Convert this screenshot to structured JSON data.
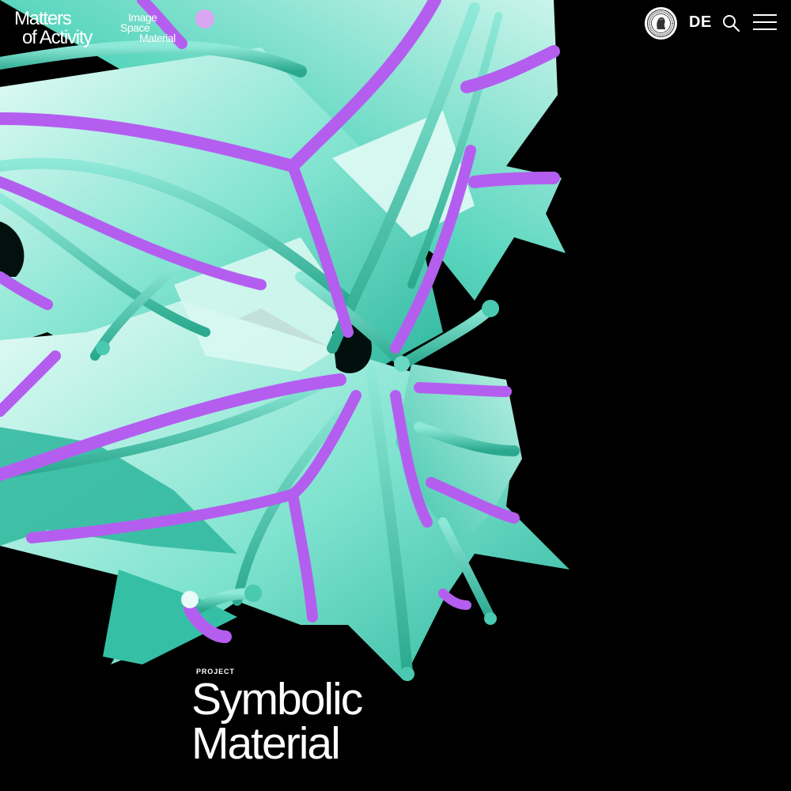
{
  "header": {
    "logo": {
      "line1": "Matters",
      "line2": "of Activity",
      "sub1": "Image",
      "sub2": "Space",
      "sub3": "Material"
    },
    "seal_icon": "university-seal-icon",
    "language_label": "DE",
    "search_icon": "search-icon",
    "menu_icon": "hamburger-menu-icon"
  },
  "hero": {
    "eyebrow": "PROJECT",
    "title_line1": "Symbolic",
    "title_line2": "Material"
  },
  "colors": {
    "background": "#000000",
    "teal": "#4fd1b8",
    "teal_light": "#c8f4ea",
    "violet": "#b45ef0",
    "dot": "#d9a6f2"
  }
}
